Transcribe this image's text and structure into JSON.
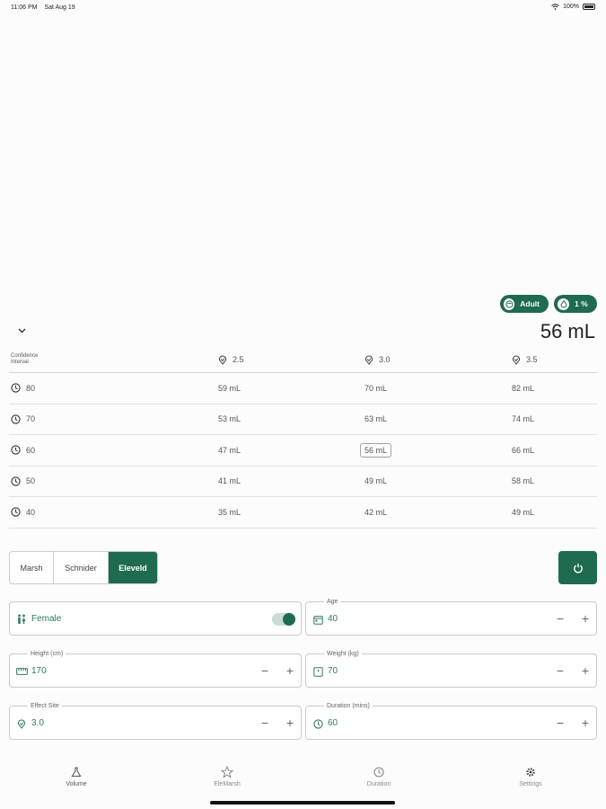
{
  "status_bar": {
    "time": "11:06 PM",
    "date": "Sat Aug 19",
    "battery": "100%"
  },
  "badges": {
    "patient": "Adult",
    "concentration": "1 %"
  },
  "summary": {
    "total_volume": "56 mL"
  },
  "table": {
    "ci_label_line1": "Confidence",
    "ci_label_line2": "Interval",
    "effect_site_headers": [
      "2.5",
      "3.0",
      "3.5"
    ],
    "rows": [
      {
        "duration": "80",
        "values": [
          "59 mL",
          "70 mL",
          "82 mL"
        ]
      },
      {
        "duration": "70",
        "values": [
          "53 mL",
          "63 mL",
          "74 mL"
        ]
      },
      {
        "duration": "60",
        "values": [
          "47 mL",
          "56 mL",
          "66 mL"
        ]
      },
      {
        "duration": "50",
        "values": [
          "41 mL",
          "49 mL",
          "58 mL"
        ]
      },
      {
        "duration": "40",
        "values": [
          "35 mL",
          "42 mL",
          "49 mL"
        ]
      }
    ],
    "selected": "56 mL"
  },
  "models": {
    "options": [
      "Marsh",
      "Schnider",
      "Eleveld"
    ],
    "selected": "Eleveld"
  },
  "inputs": {
    "sex": {
      "value": "Female",
      "toggle_on": true
    },
    "age": {
      "label": "Age",
      "value": "40"
    },
    "height": {
      "label": "Height (cm)",
      "value": "170"
    },
    "weight": {
      "label": "Weight (kg)",
      "value": "70"
    },
    "effect_site": {
      "label": "Effect Site",
      "value": "3.0"
    },
    "duration": {
      "label": "Duration (mins)",
      "value": "60"
    }
  },
  "stepper": {
    "minus": "−",
    "plus": "+"
  },
  "tabs": [
    {
      "label": "Volume",
      "icon": "flask-icon",
      "active": true
    },
    {
      "label": "EleMarsh",
      "icon": "star-network-icon",
      "active": false
    },
    {
      "label": "Duration",
      "icon": "clock-icon",
      "active": false
    },
    {
      "label": "Settings",
      "icon": "gear-icon",
      "active": false
    }
  ],
  "colors": {
    "accent": "#1f6b4f",
    "value_text": "#2e7a5c",
    "background": "#fbfcfb"
  }
}
